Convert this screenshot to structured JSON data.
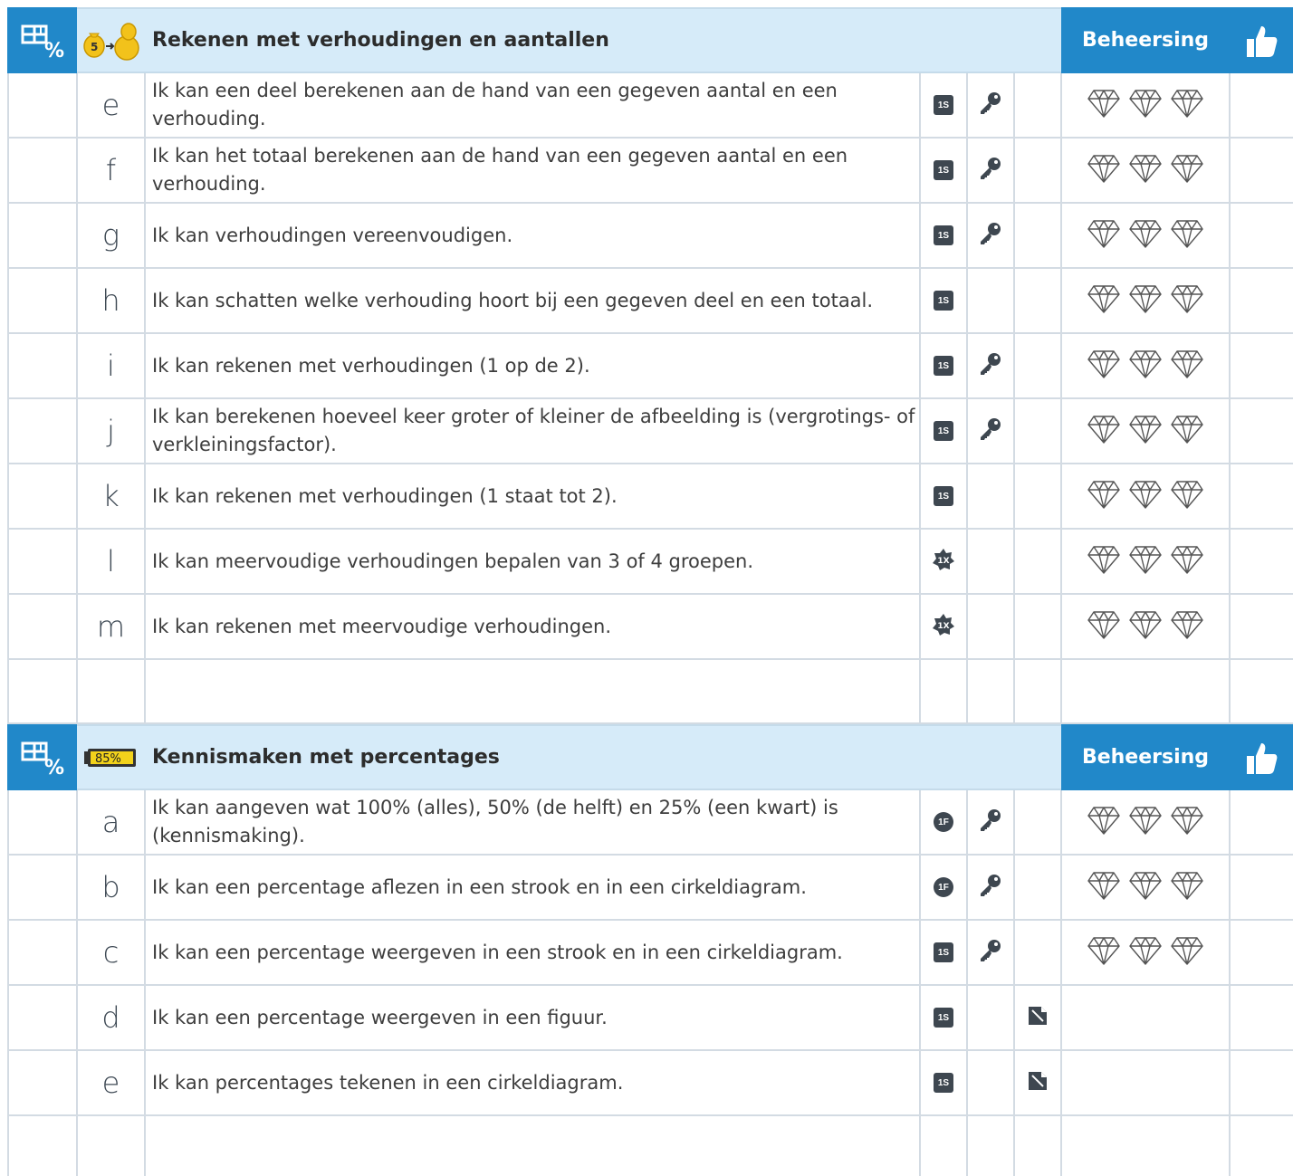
{
  "section1": {
    "title": "Rekenen met verhoudingen en aantallen",
    "mastery_label": "Beheersing",
    "rows": [
      {
        "letter": "e",
        "text": "Ik kan een deel berekenen aan de hand van een gegeven aantal en een verhouding.",
        "badge": "1S",
        "badge_shape": "square",
        "key": true,
        "note": false,
        "diamonds": true
      },
      {
        "letter": "f",
        "text": "Ik kan het totaal berekenen aan de hand van een gegeven aantal en een verhouding.",
        "badge": "1S",
        "badge_shape": "square",
        "key": true,
        "note": false,
        "diamonds": true
      },
      {
        "letter": "g",
        "text": "Ik kan verhoudingen vereenvoudigen.",
        "badge": "1S",
        "badge_shape": "square",
        "key": true,
        "note": false,
        "diamonds": true
      },
      {
        "letter": "h",
        "text": "Ik kan schatten welke verhouding hoort bij een gegeven deel en een totaal.",
        "badge": "1S",
        "badge_shape": "square",
        "key": false,
        "note": false,
        "diamonds": true
      },
      {
        "letter": "i",
        "text": "Ik kan rekenen met verhoudingen (1 op de 2).",
        "badge": "1S",
        "badge_shape": "square",
        "key": true,
        "note": false,
        "diamonds": true
      },
      {
        "letter": "j",
        "text": "Ik kan berekenen hoeveel keer groter of kleiner de afbeelding is (vergrotings- of verkleiningsfactor).",
        "badge": "1S",
        "badge_shape": "square",
        "key": true,
        "note": false,
        "diamonds": true
      },
      {
        "letter": "k",
        "text": "Ik kan rekenen met verhoudingen (1 staat tot 2).",
        "badge": "1S",
        "badge_shape": "square",
        "key": false,
        "note": false,
        "diamonds": true
      },
      {
        "letter": "l",
        "text": "Ik kan meervoudige verhoudingen bepalen van 3 of 4 groepen.",
        "badge": "1X",
        "badge_shape": "star",
        "key": false,
        "note": false,
        "diamonds": true
      },
      {
        "letter": "m",
        "text": "Ik kan rekenen met meervoudige verhoudingen.",
        "badge": "1X",
        "badge_shape": "star",
        "key": false,
        "note": false,
        "diamonds": true
      }
    ]
  },
  "section2": {
    "title": "Kennismaken met percentages",
    "mastery_label": "Beheersing",
    "battery_label": "85%",
    "rows": [
      {
        "letter": "a",
        "text": "Ik kan aangeven wat 100% (alles), 50% (de helft) en 25% (een kwart) is (kennismaking).",
        "badge": "1F",
        "badge_shape": "circle",
        "key": true,
        "note": false,
        "diamonds": true
      },
      {
        "letter": "b",
        "text": "Ik kan een percentage aflezen in een strook en in een cirkeldiagram.",
        "badge": "1F",
        "badge_shape": "circle",
        "key": true,
        "note": false,
        "diamonds": true
      },
      {
        "letter": "c",
        "text": "Ik kan een percentage weergeven in een strook en in een cirkeldiagram.",
        "badge": "1S",
        "badge_shape": "square",
        "key": true,
        "note": false,
        "diamonds": true
      },
      {
        "letter": "d",
        "text": "Ik kan een percentage weergeven in een figuur.",
        "badge": "1S",
        "badge_shape": "square",
        "key": false,
        "note": true,
        "diamonds": false
      },
      {
        "letter": "e",
        "text": "Ik kan percentages tekenen in een cirkeldiagram.",
        "badge": "1S",
        "badge_shape": "square",
        "key": false,
        "note": true,
        "diamonds": false
      }
    ]
  },
  "money_icon_label": "5",
  "colors": {
    "header_blue": "#2188c9",
    "header_light": "#d6ebf9",
    "grid": "#d3dbe3",
    "badge_dark": "#3e4750"
  }
}
